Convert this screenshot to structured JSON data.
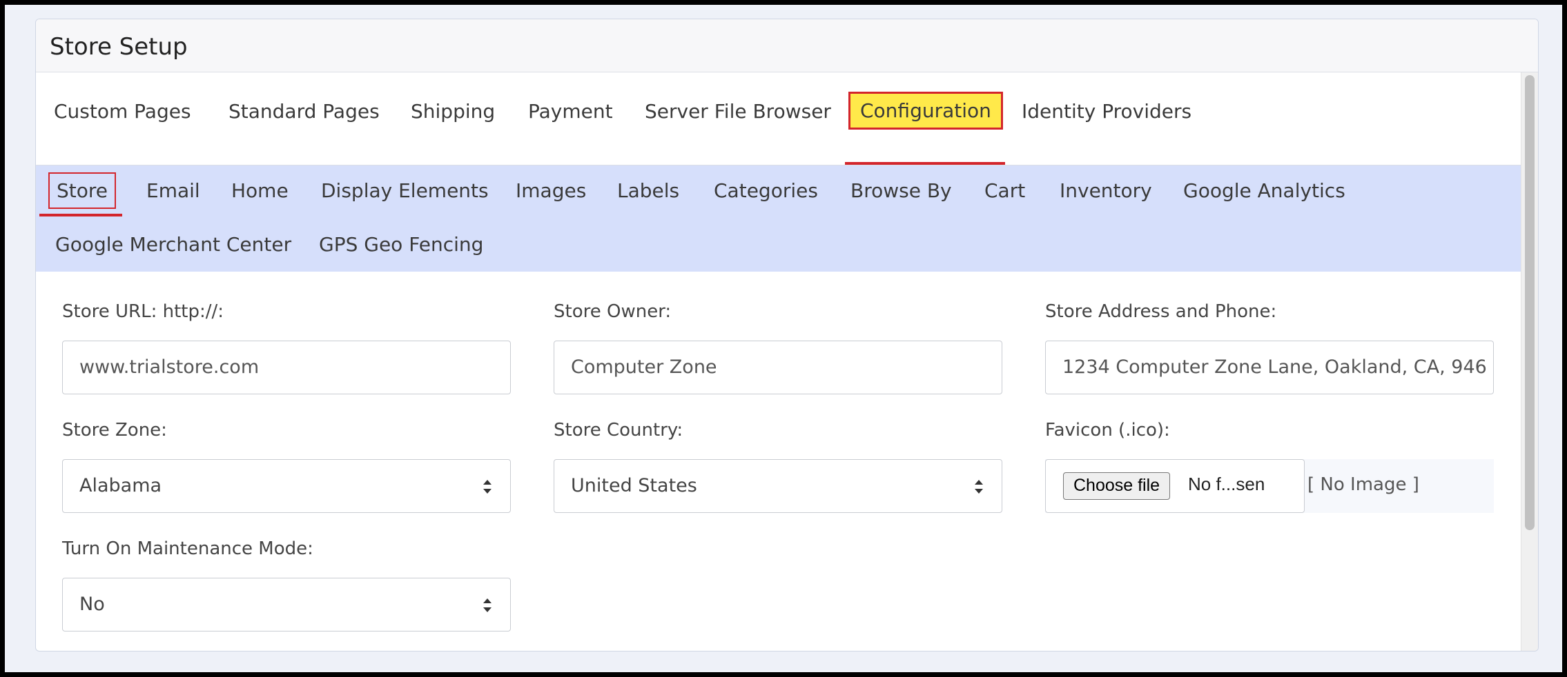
{
  "panel": {
    "title": "Store Setup"
  },
  "main_tabs": [
    {
      "label": "Custom Pages"
    },
    {
      "label": "Standard Pages"
    },
    {
      "label": "Shipping"
    },
    {
      "label": "Payment"
    },
    {
      "label": "Server File Browser"
    },
    {
      "label": "Configuration",
      "active": true
    },
    {
      "label": "Identity Providers"
    }
  ],
  "sub_tabs": [
    {
      "label": "Store",
      "active": true
    },
    {
      "label": "Email"
    },
    {
      "label": "Home"
    },
    {
      "label": "Display Elements"
    },
    {
      "label": "Images"
    },
    {
      "label": "Labels"
    },
    {
      "label": "Categories"
    },
    {
      "label": "Browse By"
    },
    {
      "label": "Cart"
    },
    {
      "label": "Inventory"
    },
    {
      "label": "Google Analytics"
    },
    {
      "label": "Google Merchant Center"
    },
    {
      "label": "GPS Geo Fencing"
    }
  ],
  "form": {
    "store_url": {
      "label": "Store URL: http://:",
      "value": "www.trialstore.com"
    },
    "store_owner": {
      "label": "Store Owner:",
      "value": "Computer Zone"
    },
    "store_address": {
      "label": "Store Address and Phone:",
      "value": "1234 Computer Zone Lane, Oakland, CA, 946"
    },
    "store_zone": {
      "label": "Store Zone:",
      "value": "Alabama"
    },
    "store_country": {
      "label": "Store Country:",
      "value": "United States"
    },
    "favicon": {
      "label": "Favicon (.ico):",
      "button_label": "Choose file",
      "file_status": "No f...sen",
      "preview_text": "[ No Image ]"
    },
    "maintenance": {
      "label": "Turn On Maintenance Mode:",
      "value": "No"
    }
  },
  "colors": {
    "active_tab_highlight": "#ffe94a",
    "active_outline": "#d3252b",
    "subnav_background": "#d6dffb"
  }
}
